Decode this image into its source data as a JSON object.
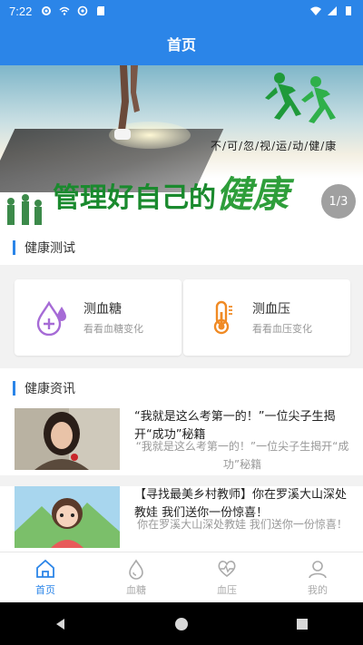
{
  "status_bar": {
    "time": "7:22"
  },
  "app_bar": {
    "title": "首页"
  },
  "banner": {
    "slogan_small": "不/可/忽/视/运/动/健/康",
    "slogan_big_plain": "管理好自己的",
    "slogan_big_emph": "健康",
    "counter": "1/3"
  },
  "health_test": {
    "heading": "健康测试",
    "tools": [
      {
        "title": "测血糖",
        "subtitle": "看看血糖变化",
        "icon": "blood-drop-plus-icon",
        "color": "#a66bd6"
      },
      {
        "title": "测血压",
        "subtitle": "看看血压变化",
        "icon": "thermometer-icon",
        "color": "#f08a24"
      }
    ]
  },
  "health_news": {
    "heading": "健康资讯",
    "items": [
      {
        "title": "“我就是这么考第一的！”一位尖子生揭开“成功”秘籍",
        "desc": "“我就是这么考第一的！”一位尖子生揭开“成功”秘籍"
      },
      {
        "title": "【寻找最美乡村教师】你在罗溪大山深处教娃 我们送你一份惊喜！",
        "desc": "你在罗溪大山深处教娃 我们送你一份惊喜！"
      }
    ]
  },
  "tab_bar": {
    "tabs": [
      {
        "label": "首页",
        "icon": "home-icon",
        "active": true
      },
      {
        "label": "血糖",
        "icon": "drop-icon",
        "active": false
      },
      {
        "label": "血压",
        "icon": "heart-pulse-icon",
        "active": false
      },
      {
        "label": "我的",
        "icon": "user-icon",
        "active": false
      }
    ]
  },
  "colors": {
    "primary": "#2b85e8",
    "banner_green": "#1a8a2e"
  }
}
